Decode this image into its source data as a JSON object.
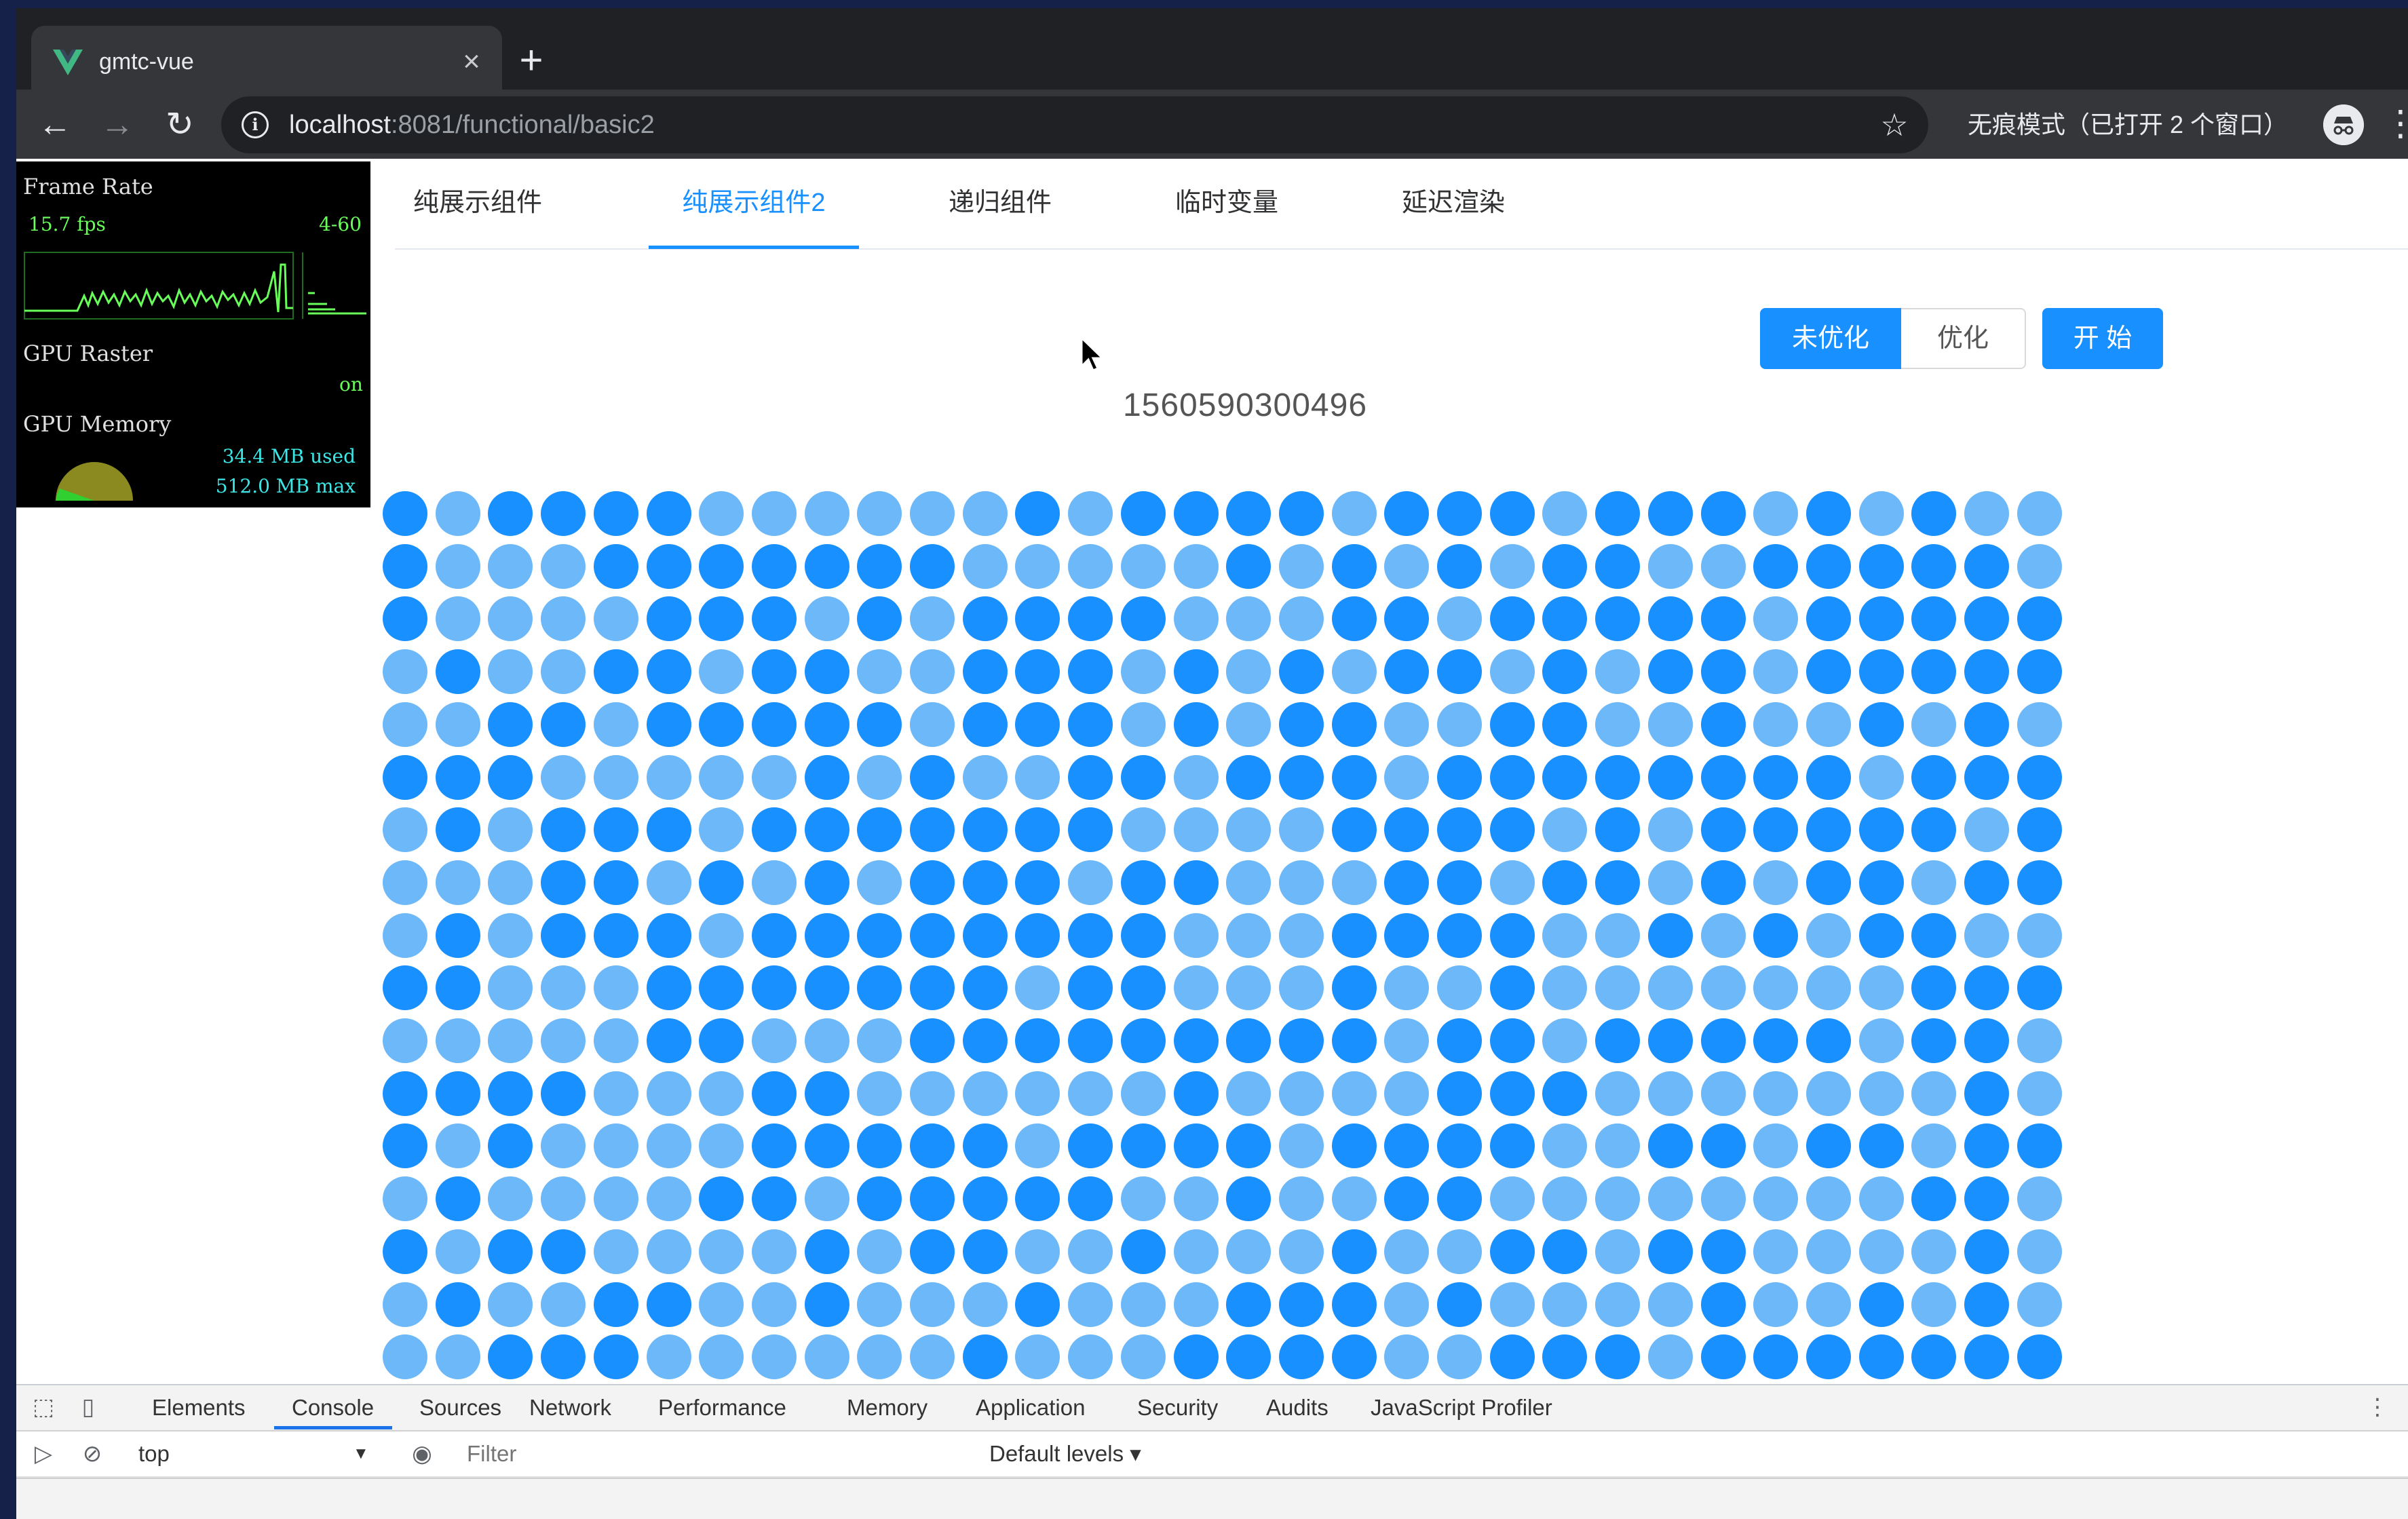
{
  "browser": {
    "tab_title": "gmtc-vue",
    "tab_close": "×",
    "new_tab": "+",
    "url_host": "localhost",
    "url_rest": ":8081/functional/basic2",
    "incognito_label": "无痕模式（已打开 2 个窗口）"
  },
  "fps_meter": {
    "frame_rate_label": "Frame Rate",
    "fps_value": "15.7 fps",
    "fps_range": "4-60",
    "gpu_raster_label": "GPU Raster",
    "gpu_raster_value": "on",
    "gpu_memory_label": "GPU Memory",
    "gpu_memory_used": "34.4 MB used",
    "gpu_memory_max": "512.0 MB max"
  },
  "page": {
    "tabs": [
      "纯展示组件",
      "纯展示组件2",
      "递归组件",
      "临时变量",
      "延迟渲染"
    ],
    "active_tab": 1,
    "buttons": {
      "unoptimized": "未优化",
      "optimized": "优化",
      "start": "开 始"
    },
    "timestamp": "1560590300496",
    "dot_grid": {
      "columns": 32,
      "visible_rows": 17,
      "dark_color": "#1890ff",
      "light_color": "#6cb8f8",
      "rows": [
        "DLDDDDLLLLLLDLDDDDLDDDLDDDLDLDLL",
        "DLLLDDDDDDDLLLLLDLDLDLDDLLDDDDDL",
        "DLLLLDDDLDLDDDDLLLDDLDDDDDLDDDDD",
        "LDLLDDLDDLLDDDLDLDLDDLDLDDLDDDDD",
        "LLDDLDDDDDLDDDLDLDDLLDDLLDLLDLDL",
        "DDDLLLLLDLDLLDDLDDDLDDDDDDDDLDDD",
        "LDLDDDLDDDDDDDLLLLDDDDLDLDDDDDLD",
        "LLLDDLDLDLDDDLDDLLLDDLDDLDLDDLDD",
        "LDLDDDLDDDDDDDDLLLDDDDLLDLDLDDLL",
        "DDLLLDDDDDDDLDDLLLDLLDLLLLLLLDDD",
        "LLLLLDDLLLDDDDDDDDDLDDLDDDDDLDDL",
        "DDDDLLLDDLLLLLLDLLLLDDDLLLLLLLDL",
        "DLDLLLLDDDDDLDDDDLDDDDLLDDLDDLDD",
        "LDLLLLDDLDDDDDLLDLLDDLLLLLLLLDDL",
        "DLDDLLLLDLDDLLDLLLDLLDDLDDLLLLDL",
        "LDLLDDLLDLLLDLLLDDDLDLLLLDLLDLDL",
        "LLDDDLLLLLLDLLLDDDDLLDDDLDDDDDDD"
      ]
    }
  },
  "devtools": {
    "tabs": [
      "Elements",
      "Console",
      "Sources",
      "Network",
      "Performance",
      "Memory",
      "Application",
      "Security",
      "Audits",
      "JavaScript Profiler"
    ],
    "active_tab": 1,
    "context": "top",
    "filter_placeholder": "Filter",
    "levels": "Default levels ▾"
  }
}
